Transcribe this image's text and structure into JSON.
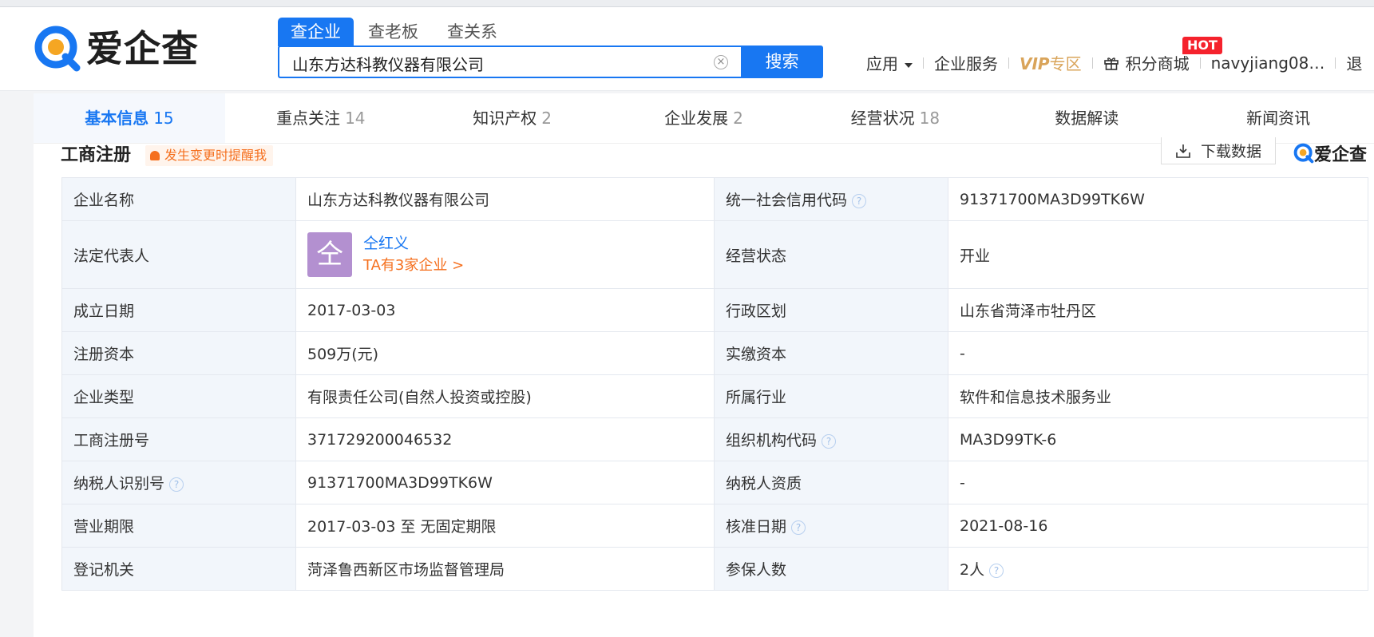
{
  "header": {
    "brand": "爱企查",
    "search_tabs": [
      "查企业",
      "查老板",
      "查关系"
    ],
    "search_value": "山东方达科教仪器有限公司",
    "search_button": "搜索",
    "nav": {
      "apps": "应用",
      "enterprise_service": "企业服务",
      "vip": "VIP",
      "vip_zone": "专区",
      "points_mall": "积分商城",
      "hot_badge": "HOT",
      "username": "navyjiang08…",
      "logout": "退"
    }
  },
  "tabs": [
    {
      "label": "基本信息",
      "count": "15"
    },
    {
      "label": "重点关注",
      "count": "14"
    },
    {
      "label": "知识产权",
      "count": "2"
    },
    {
      "label": "企业发展",
      "count": "2"
    },
    {
      "label": "经营状况",
      "count": "18"
    },
    {
      "label": "数据解读",
      "count": ""
    },
    {
      "label": "新闻资讯",
      "count": ""
    }
  ],
  "section": {
    "title": "工商注册",
    "remind": "发生变更时提醒我",
    "download": "下载数据",
    "watermark": "爱企查"
  },
  "info": {
    "row1": {
      "k1": "企业名称",
      "v1": "山东方达科教仪器有限公司",
      "k2": "统一社会信用代码",
      "v2": "91371700MA3D99TK6W"
    },
    "row2": {
      "k1": "法定代表人",
      "avatar": "仝",
      "name": "仝红义",
      "more": "TA有3家企业 >",
      "k2": "经营状态",
      "v2": "开业"
    },
    "row3": {
      "k1": "成立日期",
      "v1": "2017-03-03",
      "k2": "行政区划",
      "v2": "山东省菏泽市牡丹区"
    },
    "row4": {
      "k1": "注册资本",
      "v1": "509万(元)",
      "k2": "实缴资本",
      "v2": "-"
    },
    "row5": {
      "k1": "企业类型",
      "v1": "有限责任公司(自然人投资或控股)",
      "k2": "所属行业",
      "v2": "软件和信息技术服务业"
    },
    "row6": {
      "k1": "工商注册号",
      "v1": "371729200046532",
      "k2": "组织机构代码",
      "v2": "MA3D99TK-6"
    },
    "row7": {
      "k1": "纳税人识别号",
      "v1": "91371700MA3D99TK6W",
      "k2": "纳税人资质",
      "v2": "-"
    },
    "row8": {
      "k1": "营业期限",
      "v1": "2017-03-03 至 无固定期限",
      "k2": "核准日期",
      "v2": "2021-08-16"
    },
    "row9": {
      "k1": "登记机关",
      "v1": "菏泽鲁西新区市场监督管理局",
      "k2": "参保人数",
      "v2": "2人"
    }
  }
}
